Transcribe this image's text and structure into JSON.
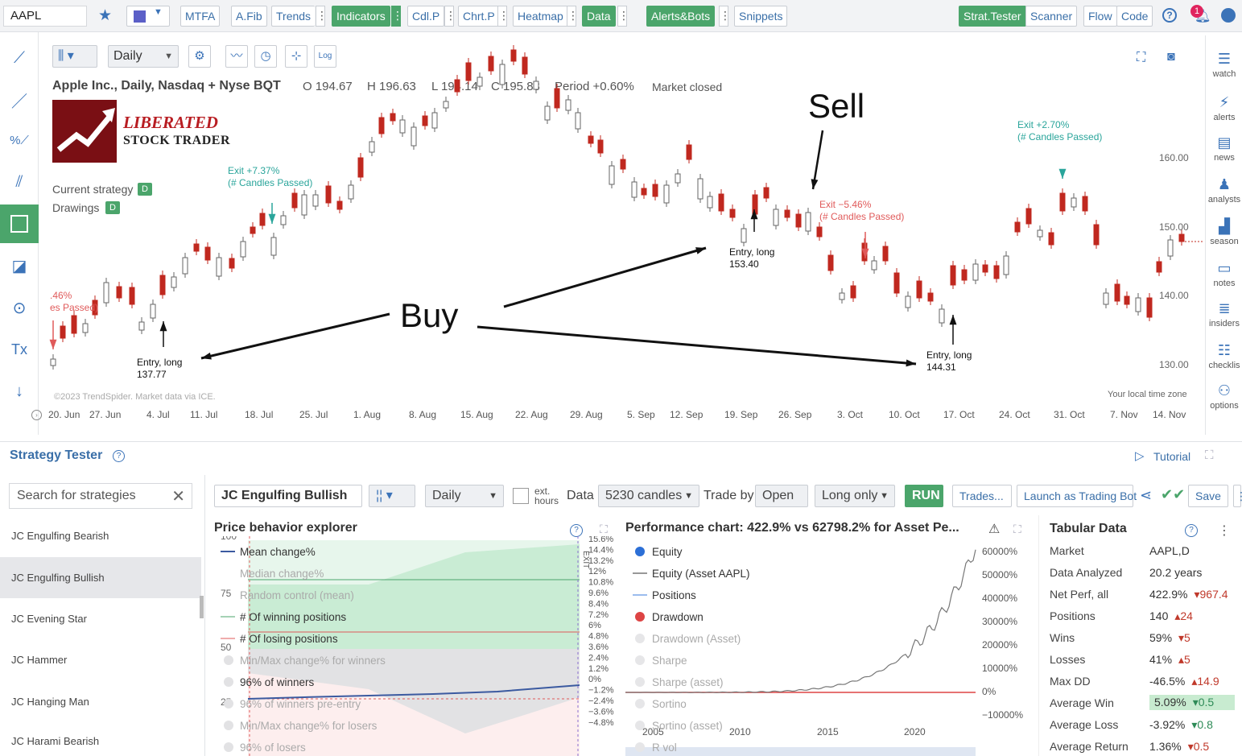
{
  "toolbar": {
    "symbol": "AAPL",
    "buttons": [
      "MTFA",
      "A.Fib",
      "Trends",
      "Indicators",
      "Cdl.P",
      "Chrt.P",
      "Heatmap",
      "Data",
      "Alerts&Bots",
      "Snippets"
    ],
    "right_buttons": [
      "Strat.Tester",
      "Scanner",
      "Flow",
      "Code"
    ],
    "notif_count": "1",
    "colors": {
      "green": "#4ba56b",
      "blue": "#3a6fa8"
    }
  },
  "right_panel": [
    "watch",
    "alerts",
    "news",
    "analysts",
    "season",
    "notes",
    "insiders",
    "checklis",
    "options"
  ],
  "chart": {
    "timeframe": "Daily",
    "log_label": "Log",
    "title": "Apple Inc., Daily, Nasdaq + Nyse BQT",
    "ohlc": {
      "o": "O 194.67",
      "h": "H 196.63",
      "l": "L 194.14",
      "c": "C 195.83"
    },
    "period": "Period +0.60%",
    "market_status": "Market closed",
    "logo_line1": "LIBERATED",
    "logo_line2": "STOCK TRADER",
    "current_strategy": "Current strategy",
    "drawings": "Drawings",
    "badge": "D",
    "copyright": "©2023 TrendSpider. Market data via ICE.",
    "timezone": "Your local time zone",
    "y_ticks": [
      "160.00",
      "150.00",
      "140.00",
      "130.00"
    ],
    "x_ticks": [
      "20. Jun",
      "27. Jun",
      "4. Jul",
      "11. Jul",
      "18. Jul",
      "25. Jul",
      "1. Aug",
      "8. Aug",
      "15. Aug",
      "22. Aug",
      "29. Aug",
      "5. Sep",
      "12. Sep",
      "19. Sep",
      "26. Sep",
      "3. Oct",
      "10. Oct",
      "17. Oct",
      "24. Oct",
      "31. Oct",
      "7. Nov",
      "14. Nov"
    ],
    "annotations": {
      "buy": "Buy",
      "sell": "Sell",
      "entry1_a": "Entry, long",
      "entry1_b": "137.77",
      "entry2_a": "Entry, long",
      "entry2_b": "153.40",
      "entry3_a": "Entry, long",
      "entry3_b": "144.31",
      "exit1_a": "Exit +7.37%",
      "exit1_b": "(# Candles Passed)",
      "exit2_a": "Exit −5.46%",
      "exit2_b": "(# Candles Passed)",
      "exit3_a": "Exit +2.70%",
      "exit3_b": "(# Candles Passed)",
      "partial_a": ".46%",
      "partial_b": "es Passed)"
    }
  },
  "strategy_tester": {
    "title": "Strategy Tester",
    "tutorial": "Tutorial",
    "search_placeholder": "Search for strategies",
    "strategies": [
      "JC Engulfing Bearish",
      "JC Engulfing Bullish",
      "JC Evening Star",
      "JC Hammer",
      "JC Hanging Man",
      "JC Harami Bearish"
    ],
    "selected_strategy": "JC Engulfing Bullish",
    "timeframe": "Daily",
    "ext_hours": "ext.\nhours",
    "data_label": "Data",
    "candles": "5230 candles",
    "trade_by": "Trade by",
    "trade_by_value": "Open",
    "direction": "Long only",
    "run": "RUN",
    "trades": "Trades...",
    "launch_bot": "Launch as Trading Bot",
    "save": "Save"
  },
  "price_explorer": {
    "title": "Price behavior explorer",
    "legend": [
      "Mean change%",
      "Median change%",
      "Random control (mean)",
      "# Of winning positions",
      "# Of losing positions",
      "Min/Max change% for winners",
      "96% of winners",
      "96% of winners pre-entry",
      "Min/Max change% for losers",
      "96% of losers"
    ],
    "y_left": [
      "100",
      "75",
      "50",
      "25"
    ],
    "y_right": [
      "15.6%",
      "14.4%",
      "13.2%",
      "12%",
      "10.8%",
      "9.6%",
      "8.4%",
      "7.2%",
      "6%",
      "4.8%",
      "3.6%",
      "2.4%",
      "1.2%",
      "0%",
      "−1.2%",
      "−2.4%",
      "−3.6%",
      "−4.8%"
    ],
    "exit_label": "EXIT"
  },
  "performance": {
    "title": "Performance chart: 422.9% vs 62798.2% for Asset Pe...",
    "legend": [
      "Equity",
      "Equity (Asset AAPL)",
      "Positions",
      "Drawdown",
      "Drawdown (Asset)",
      "Sharpe",
      "Sharpe (asset)",
      "Sortino",
      "Sortino (asset)",
      "R vol"
    ],
    "y_ticks": [
      "60000%",
      "50000%",
      "40000%",
      "30000%",
      "20000%",
      "10000%",
      "0%",
      "−10000%"
    ],
    "x_ticks": [
      "2005",
      "2010",
      "2015",
      "2020"
    ]
  },
  "tabular": {
    "title": "Tabular Data",
    "rows": [
      {
        "k": "Market",
        "v": "AAPL,D",
        "d": ""
      },
      {
        "k": "Data Analyzed",
        "v": "20.2 years",
        "d": ""
      },
      {
        "k": "Net Perf, all",
        "v": "422.9%",
        "d": "▾967.4"
      },
      {
        "k": "Positions",
        "v": "140",
        "d": "▴24"
      },
      {
        "k": "Wins",
        "v": "59%",
        "d": "▾5"
      },
      {
        "k": "Losses",
        "v": "41%",
        "d": "▴5"
      },
      {
        "k": "Max DD",
        "v": "-46.5%",
        "d": "▴14.9"
      },
      {
        "k": "Average Win",
        "v": "5.09%",
        "d": "▾0.5"
      },
      {
        "k": "Average Loss",
        "v": "-3.92%",
        "d": "▾0.8"
      },
      {
        "k": "Average Return",
        "v": "1.36%",
        "d": "▾0.5"
      }
    ]
  }
}
